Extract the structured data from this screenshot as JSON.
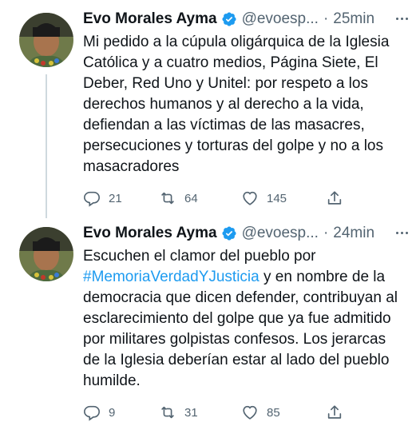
{
  "tweets": [
    {
      "author": "Evo Morales Ayma",
      "handle": "@evoesp...",
      "separator": "·",
      "time": "25min",
      "text": "Mi pedido a la cúpula oligárquica de la Iglesia Católica y a cuatro medios, Página Siete, El Deber, Red Uno y Unitel: por respeto a los derechos humanos y al derecho a la vida, defiendan a las víctimas de las masacres, persecuciones y torturas del golpe y no a los masacradores",
      "replies": "21",
      "retweets": "64",
      "likes": "145"
    },
    {
      "author": "Evo Morales Ayma",
      "handle": "@evoesp...",
      "separator": "·",
      "time": "24min",
      "text_before": "Escuchen el clamor del pueblo por ",
      "hashtag": "#MemoriaVerdadYJusticia",
      "text_after": " y en nombre de la democracia que dicen defender, contribuyan al esclarecimiento del golpe que ya fue admitido por militares golpistas confesos. Los jerarcas de la Iglesia deberían estar al lado del pueblo humilde.",
      "replies": "9",
      "retweets": "31",
      "likes": "85"
    }
  ],
  "colors": {
    "accent": "#1d9bf0",
    "secondary_text": "#536471",
    "primary_text": "#0f1419",
    "thread_line": "#cfd9de"
  },
  "icons": [
    "verified-badge-icon",
    "more-icon",
    "reply-icon",
    "retweet-icon",
    "like-icon",
    "share-icon"
  ]
}
